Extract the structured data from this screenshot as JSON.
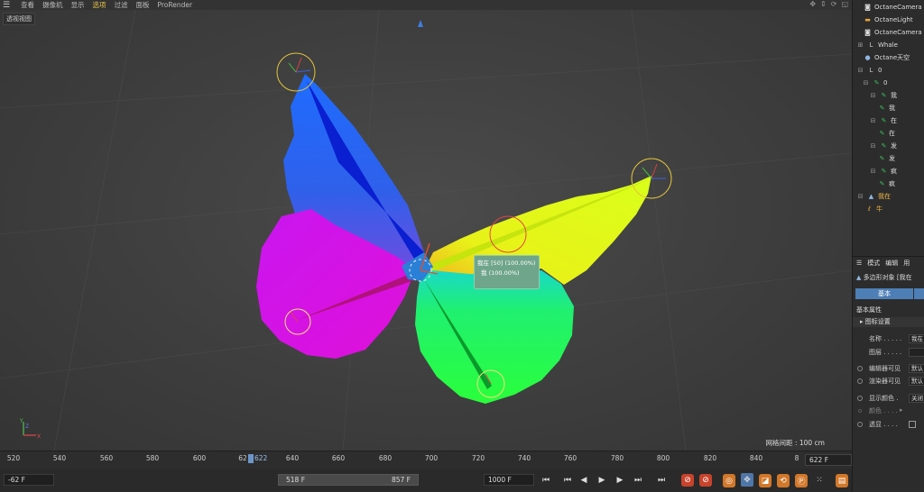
{
  "menu": {
    "items": [
      "查看",
      "摄像机",
      "显示",
      "选项",
      "过滤",
      "面板",
      "ProRender"
    ],
    "active_index": 3
  },
  "viewport": {
    "label": "透视视图",
    "grid_distance": "网格间距 : 100 cm",
    "tooltip_line1": "我在 [50] (100.00%)",
    "tooltip_line2": "我 (100.00%)",
    "axis_y": "Y",
    "axis_z": "Z",
    "axis_x": "X"
  },
  "timeline": {
    "ticks": [
      "520",
      "540",
      "560",
      "580",
      "600",
      "62",
      "640",
      "660",
      "680",
      "700",
      "720",
      "740",
      "760",
      "780",
      "800",
      "820",
      "840",
      "8"
    ],
    "playhead_label": "622",
    "current_frame": "622 F"
  },
  "transport": {
    "start_field": "-62 F",
    "range_start": "518 F",
    "range_end": "857 F",
    "end_field": "1000 F"
  },
  "objects": [
    {
      "label": "OctaneCamera",
      "icon": "camera-icon",
      "indent": 0
    },
    {
      "label": "OctaneLight",
      "icon": "light-icon",
      "indent": 0
    },
    {
      "label": "OctaneCamera",
      "icon": "camera-icon",
      "indent": 0
    },
    {
      "label": "Whale",
      "icon": "null-icon",
      "indent": 0
    },
    {
      "label": "Octane天空",
      "icon": "sky-icon",
      "indent": 0
    },
    {
      "label": "0",
      "icon": "null-icon",
      "indent": 0
    },
    {
      "label": "0",
      "icon": "bone-icon",
      "indent": 1
    },
    {
      "label": "我",
      "icon": "bone-icon",
      "indent": 2
    },
    {
      "label": "我",
      "icon": "bone-icon",
      "indent": 3
    },
    {
      "label": "在",
      "icon": "bone-icon",
      "indent": 2
    },
    {
      "label": "在",
      "icon": "bone-icon",
      "indent": 3
    },
    {
      "label": "发",
      "icon": "bone-icon",
      "indent": 2
    },
    {
      "label": "发",
      "icon": "bone-icon",
      "indent": 3
    },
    {
      "label": "疯",
      "icon": "bone-icon",
      "indent": 2
    },
    {
      "label": "疯",
      "icon": "bone-icon",
      "indent": 3
    },
    {
      "label": "我在",
      "icon": "polygon-icon",
      "indent": 0,
      "selected": true
    },
    {
      "label": "牛",
      "icon": "skin-icon",
      "indent": 1,
      "selected": true
    }
  ],
  "attributes": {
    "tabs": [
      "模式",
      "编辑",
      "用"
    ],
    "object_title": "多边形对象 [我在",
    "tab_basic": "基本",
    "section": "基本属性",
    "icon_settings": "图标设置",
    "name_label": "名称 . . . . .",
    "name_value": "我在",
    "layer_label": "图层 . . . . .",
    "editor_visible_label": "编辑器可见",
    "editor_visible_value": "默认",
    "render_visible_label": "渲染器可见",
    "render_visible_value": "默认",
    "display_color_label": "显示颜色 .",
    "display_color_value": "关闭",
    "color_label": "颜色 . . . .",
    "transparent_label": "透显 . . . ."
  }
}
